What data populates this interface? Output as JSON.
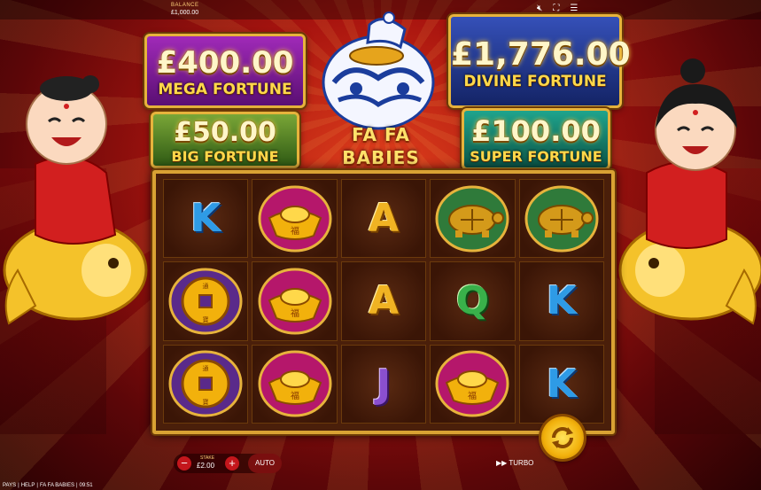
{
  "topbar": {
    "balance_label": "BALANCE",
    "balance_value": "£1,000.00",
    "icons": [
      "mute-icon",
      "fullscreen-icon",
      "menu-icon"
    ]
  },
  "jackpots": {
    "mega": {
      "amount": "£400.00",
      "name": "MEGA FORTUNE",
      "color": "#a02ab8"
    },
    "divine": {
      "amount": "£1,776.00",
      "name": "DIVINE FORTUNE",
      "color": "#3550b8"
    },
    "big": {
      "amount": "£50.00",
      "name": "BIG FORTUNE",
      "color": "#7aa637"
    },
    "super": {
      "amount": "£100.00",
      "name": "SUPER FORTUNE",
      "color": "#1fa48d"
    }
  },
  "logo": {
    "line1": "FA FA",
    "line2": "BABIES"
  },
  "reels": {
    "rows": [
      [
        "K",
        "gold-ingot",
        "A",
        "turtle",
        "turtle"
      ],
      [
        "coin",
        "gold-ingot",
        "A",
        "Q",
        "K"
      ],
      [
        "coin",
        "gold-ingot",
        "J",
        "gold-ingot",
        "K"
      ]
    ]
  },
  "controls": {
    "minus": "−",
    "plus": "+",
    "stake_label": "STAKE",
    "stake_value": "£2.00",
    "auto_label": "AUTO",
    "turbo_label": "▶▶ TURBO"
  },
  "footer": {
    "items": [
      "PAYS",
      "|",
      "HELP",
      "|",
      "FA FA BABIES",
      "|",
      "09:51"
    ]
  }
}
